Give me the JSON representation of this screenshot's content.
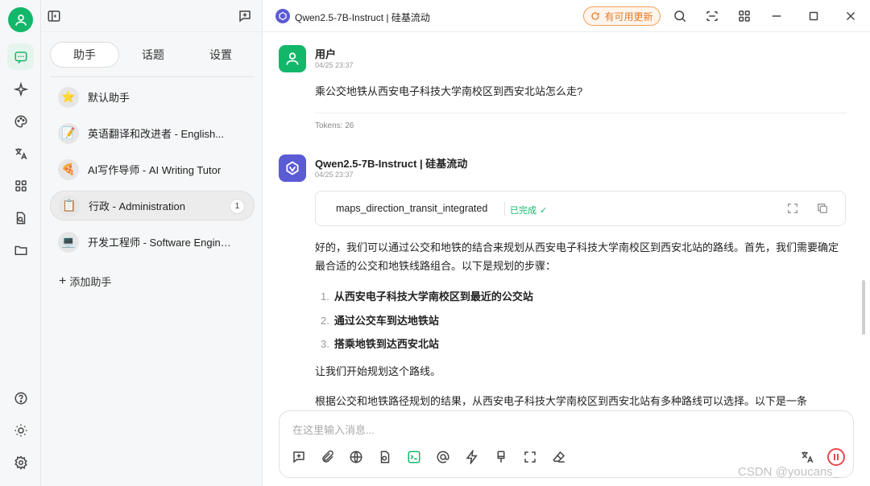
{
  "rail": {
    "icons": [
      "chat-icon",
      "sparkle-icon",
      "palette-icon",
      "translate-icon",
      "apps-icon",
      "file-search-icon",
      "folder-icon",
      "help-icon",
      "theme-sun-icon",
      "settings-gear-icon"
    ]
  },
  "panel": {
    "tabs": [
      {
        "label": "助手"
      },
      {
        "label": "话题"
      },
      {
        "label": "设置"
      }
    ],
    "assistants": [
      {
        "emoji": "⭐",
        "name": "默认助手"
      },
      {
        "emoji": "📝",
        "name": "英语翻译和改进者 - English..."
      },
      {
        "emoji": "🍕",
        "name": "AI写作导师 - AI Writing Tutor"
      },
      {
        "emoji": "📋",
        "name": "行政 - Administration",
        "badge": "1"
      },
      {
        "emoji": "💻",
        "name": "开发工程师 - Software Engineer"
      }
    ],
    "add_label": "添加助手"
  },
  "topbar": {
    "model_title": "Qwen2.5-7B-Instruct | 硅基流动",
    "update_label": "有可用更新"
  },
  "user_msg": {
    "who": "用户",
    "time": "04/25 23:37",
    "text": "乘公交地铁从西安电子科技大学南校区到西安北站怎么走?",
    "tokens": "Tokens: 26"
  },
  "bot_msg": {
    "who": "Qwen2.5-7B-Instruct | 硅基流动",
    "time": "04/25 23:37",
    "tool_name": "maps_direction_transit_integrated",
    "tool_status": "已完成",
    "intro": "好的，我们可以通过公交和地铁的结合来规划从西安电子科技大学南校区到西安北站的路线。首先，我们需要确定最合适的公交和地铁线路组合。以下是规划的步骤：",
    "steps": [
      {
        "num": "1.",
        "text": "从西安电子科技大学南校区到最近的公交站"
      },
      {
        "num": "2.",
        "text": "通过公交车到达地铁站"
      },
      {
        "num": "3.",
        "text": "搭乘地铁到达西安北站"
      }
    ],
    "after": "让我们开始规划这个路线。",
    "result": "根据公交和地铁路径规划的结果，从西安电子科技大学南校区到西安北站有多种路线可以选择。以下是一条"
  },
  "composer": {
    "placeholder": "在这里输入消息..."
  },
  "watermark": "CSDN @youcans_",
  "colors": {
    "accent_green": "#12b76a",
    "update_orange": "#e07a28",
    "stop_red": "#e5484d"
  }
}
